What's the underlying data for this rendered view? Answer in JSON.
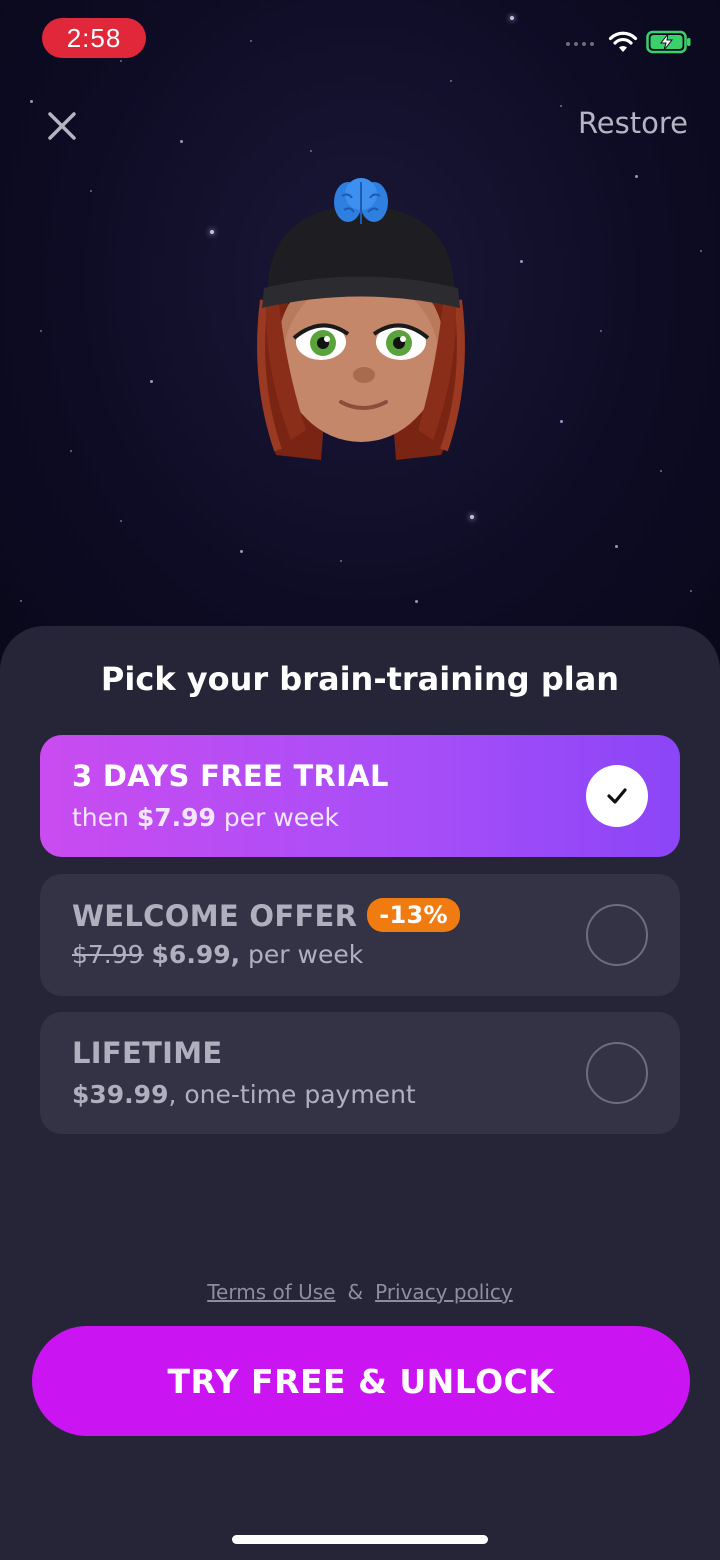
{
  "status_bar": {
    "time": "2:58",
    "wifi_icon": "wifi-icon",
    "battery_icon": "battery-charging-icon"
  },
  "header": {
    "close_icon": "close-icon",
    "restore_label": "Restore"
  },
  "hero": {
    "avatar_icon": "memoji-avatar-with-brain-beanie"
  },
  "paywall": {
    "title": "Pick your brain-training plan",
    "plans": [
      {
        "title": "3 DAYS FREE TRIAL",
        "prefix": "then ",
        "price": "$7.99",
        "suffix": " per week",
        "selected": true
      },
      {
        "title": "WELCOME OFFER",
        "badge": "-13%",
        "old_price": "$7.99",
        "price": "$6.99,",
        "suffix": " per week",
        "selected": false
      },
      {
        "title": "LIFETIME",
        "price": "$39.99",
        "suffix": ", one-time payment",
        "selected": false
      }
    ],
    "terms_label": "Terms of Use",
    "amp": "&",
    "privacy_label": "Privacy policy",
    "cta_label": "TRY FREE & UNLOCK"
  },
  "colors": {
    "accent": "#cb14f2",
    "selected_start": "#c94cf0",
    "selected_end": "#8b45f7",
    "badge": "#f07b11",
    "sheet": "#262538",
    "card": "#343346"
  }
}
